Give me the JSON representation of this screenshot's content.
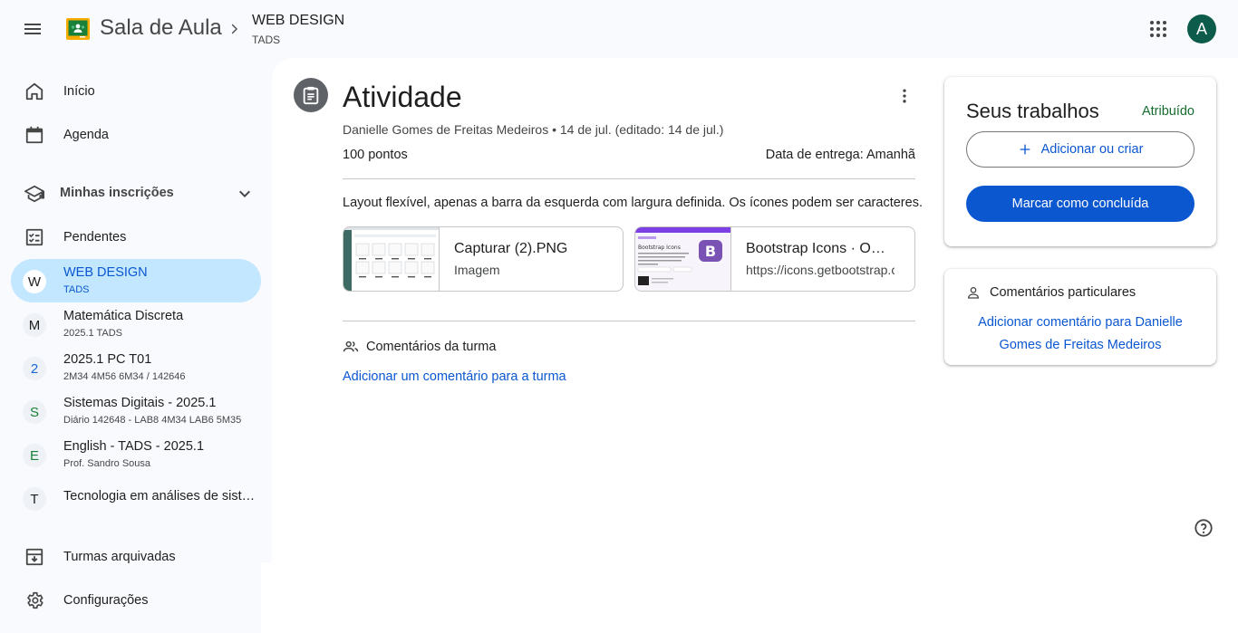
{
  "header": {
    "app_title": "Sala de Aula",
    "class_title": "WEB DESIGN",
    "class_subtitle": "TADS",
    "avatar_letter": "A",
    "avatar_color": "#0d5c4b",
    "icons": [
      "menu-icon",
      "classroom-logo-icon",
      "chevron-right-icon",
      "apps-grid-icon"
    ]
  },
  "sidebar": {
    "home": "Início",
    "calendar": "Agenda",
    "enrolled_label": "Minhas inscrições",
    "todo": "Pendentes",
    "classes": [
      {
        "badge": "W",
        "name": "WEB DESIGN",
        "sub": "TADS",
        "badge_color": "#1f1f1f",
        "active": true
      },
      {
        "badge": "M",
        "name": "Matemática Discreta",
        "sub": "2025.1 TADS",
        "badge_color": "#1f1f1f"
      },
      {
        "badge": "2",
        "name": "2025.1 PC T01",
        "sub": "2M34 4M56 6M34 / 142646",
        "badge_color": "#1967d2"
      },
      {
        "badge": "S",
        "name": "Sistemas Digitais - 2025.1",
        "sub": "Diário 142648 - LAB8 4M34 LAB6 5M35",
        "badge_color": "#188038"
      },
      {
        "badge": "E",
        "name": "English - TADS - 2025.1",
        "sub": "Prof. Sandro Sousa",
        "badge_color": "#188038"
      },
      {
        "badge": "T",
        "name": "Tecnologia em análises de sist…",
        "sub": "",
        "badge_color": "#1f1f1f"
      }
    ],
    "archived": "Turmas arquivadas",
    "settings": "Configurações"
  },
  "assignment": {
    "title": "Atividade",
    "meta": "Danielle Gomes de Freitas Medeiros • 14 de jul. (editado: 14 de jul.)",
    "points": "100 pontos",
    "due": "Data de entrega: Amanhã",
    "description": "Layout flexível, apenas a barra da esquerda com largura definida. Os ícones podem ser caracteres.",
    "attachments": [
      {
        "title": "Capturar (2).PNG",
        "subtitle": "Imagem"
      },
      {
        "title": "Bootstrap Icons · O…",
        "subtitle": "https://icons.getbootstrap.com/",
        "thumb_title": "Bootstrap Icons"
      }
    ],
    "class_comments_label": "Comentários da turma",
    "add_class_comment": "Adicionar um comentário para a turma"
  },
  "your_work": {
    "title": "Seus trabalhos",
    "status": "Atribuído",
    "status_color": "#146c2e",
    "add_or_create": "Adicionar ou criar",
    "mark_done": "Marcar como concluída",
    "accent": "#0b57d0"
  },
  "private_comments": {
    "title": "Comentários particulares",
    "add_link": "Adicionar comentário para Danielle Gomes de Freitas Medeiros"
  }
}
